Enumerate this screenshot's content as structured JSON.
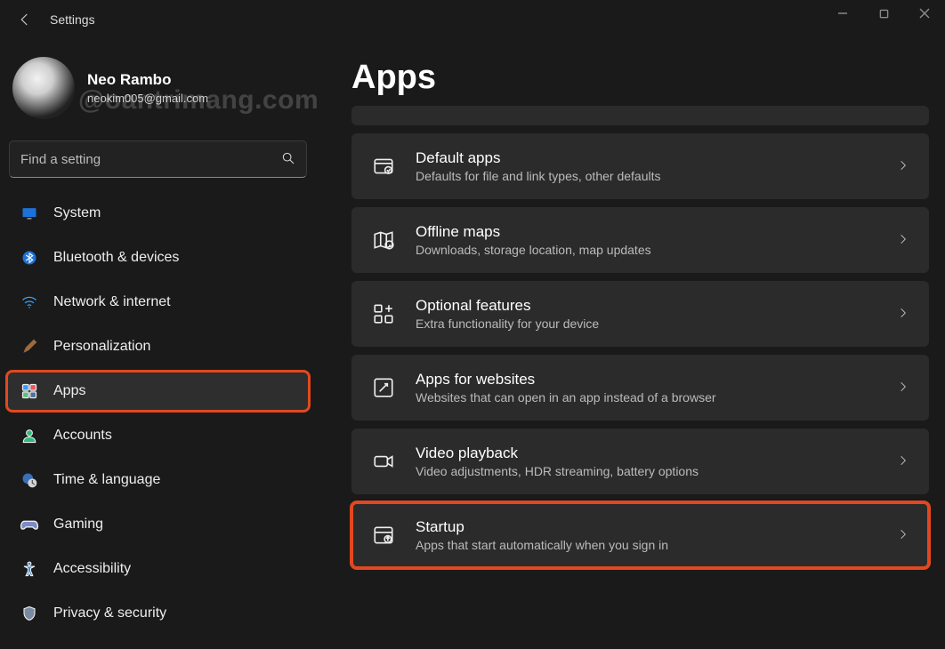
{
  "window": {
    "title": "Settings"
  },
  "user": {
    "name": "Neo Rambo",
    "email": "neokim005@gmail.com"
  },
  "watermark": "@oantrimang.com",
  "search": {
    "placeholder": "Find a setting"
  },
  "sidebar": {
    "items": [
      {
        "id": "system",
        "label": "System",
        "icon": "monitor-icon",
        "color": "#3aa3ff"
      },
      {
        "id": "bluetooth",
        "label": "Bluetooth & devices",
        "icon": "bluetooth-icon",
        "color": "#3aa3ff"
      },
      {
        "id": "network",
        "label": "Network & internet",
        "icon": "wifi-icon",
        "color": "#3aa3ff"
      },
      {
        "id": "personalization",
        "label": "Personalization",
        "icon": "paintbrush-icon",
        "color": "#ff8a4d"
      },
      {
        "id": "apps",
        "label": "Apps",
        "icon": "apps-icon",
        "color": "#2fa0ff",
        "selected": true,
        "highlighted": true
      },
      {
        "id": "accounts",
        "label": "Accounts",
        "icon": "person-icon",
        "color": "#2db97a"
      },
      {
        "id": "time",
        "label": "Time & language",
        "icon": "clock-globe-icon",
        "color": "#66a3ff"
      },
      {
        "id": "gaming",
        "label": "Gaming",
        "icon": "gamepad-icon",
        "color": "#8a8aff"
      },
      {
        "id": "accessibility",
        "label": "Accessibility",
        "icon": "accessibility-icon",
        "color": "#3aa3ff"
      },
      {
        "id": "privacy",
        "label": "Privacy & security",
        "icon": "shield-icon",
        "color": "#7a8aa0"
      }
    ]
  },
  "page": {
    "title": "Apps"
  },
  "cards": [
    {
      "id": "default-apps",
      "title": "Default apps",
      "sub": "Defaults for file and link types, other defaults",
      "icon": "default-apps-icon"
    },
    {
      "id": "offline-maps",
      "title": "Offline maps",
      "sub": "Downloads, storage location, map updates",
      "icon": "map-icon"
    },
    {
      "id": "optional-features",
      "title": "Optional features",
      "sub": "Extra functionality for your device",
      "icon": "grid-plus-icon"
    },
    {
      "id": "apps-websites",
      "title": "Apps for websites",
      "sub": "Websites that can open in an app instead of a browser",
      "icon": "app-link-icon"
    },
    {
      "id": "video-playback",
      "title": "Video playback",
      "sub": "Video adjustments, HDR streaming, battery options",
      "icon": "video-icon"
    },
    {
      "id": "startup",
      "title": "Startup",
      "sub": "Apps that start automatically when you sign in",
      "icon": "startup-icon",
      "highlighted": true
    }
  ]
}
